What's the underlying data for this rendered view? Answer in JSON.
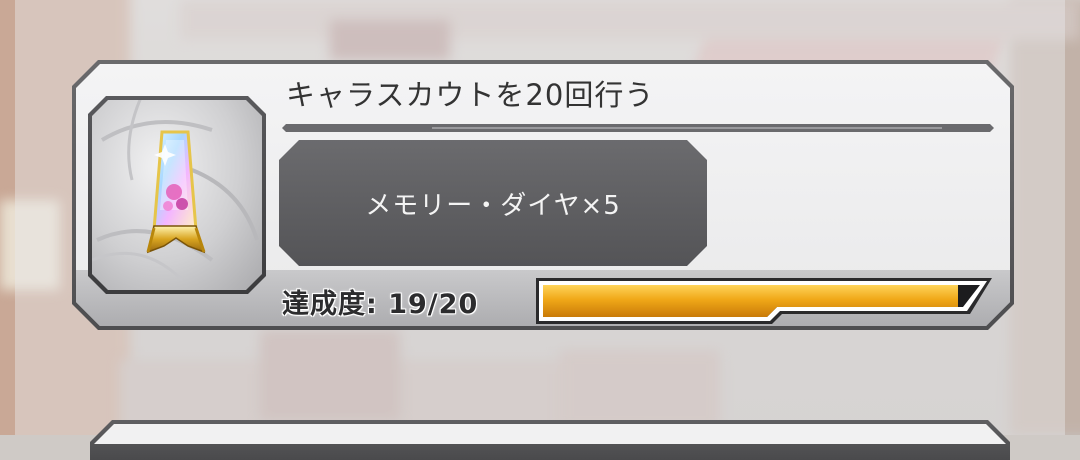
{
  "mission": {
    "title": "キャラスカウトを20回行う",
    "reward_label": "メモリー・ダイヤ×5",
    "item_icon": "memory-diamond-crystal-icon"
  },
  "progress": {
    "label_prefix": "達成度:",
    "current": 19,
    "total": 20,
    "display": "19/20",
    "fraction": 0.95
  },
  "colors": {
    "progress_fill": "#f0a818",
    "card_frame": "#505052",
    "reward_plate": "#5f5f62"
  }
}
